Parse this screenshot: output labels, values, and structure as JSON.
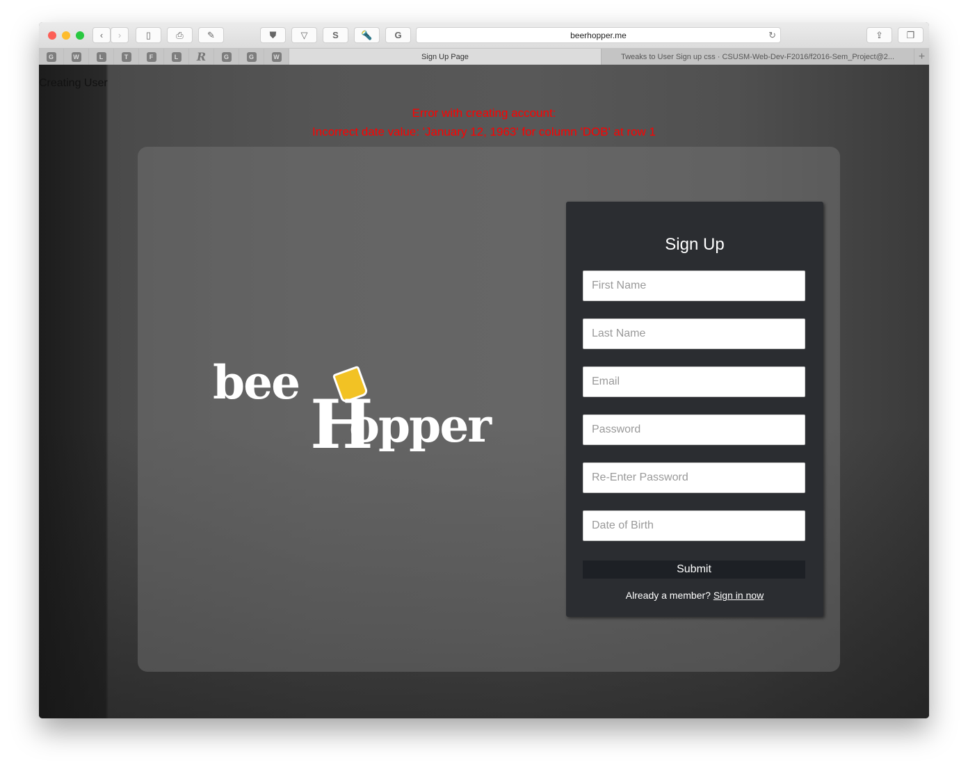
{
  "browser": {
    "url": "beerhopper.me",
    "favorites": [
      "G",
      "W",
      "L",
      "T",
      "F",
      "L",
      "R",
      "G",
      "G",
      "W"
    ],
    "tabs": [
      {
        "label": "Sign Up Page",
        "active": true
      },
      {
        "label": "Tweaks to User Sign up css · CSUSM-Web-Dev-F2016/f2016-Sem_Project@2...",
        "active": false
      }
    ]
  },
  "page": {
    "status": "Creating User",
    "error_title": "Error with creating account:",
    "error_detail": "Incorrect date value: 'January 12, 1963' for column 'DOB' at row 1",
    "logo": {
      "part1": "bee",
      "part2": "H",
      "part3": "opper"
    },
    "form": {
      "title": "Sign Up",
      "fields": [
        "First Name",
        "Last Name",
        "Email",
        "Password",
        "Re-Enter Password",
        "Date of Birth"
      ],
      "submit": "Submit",
      "member_text": "Already a member?",
      "signin_link": "Sign in now"
    }
  },
  "colors": {
    "error": "#ff0000",
    "form_bg": "#2b2d31",
    "submit_bg": "#1d2025"
  }
}
